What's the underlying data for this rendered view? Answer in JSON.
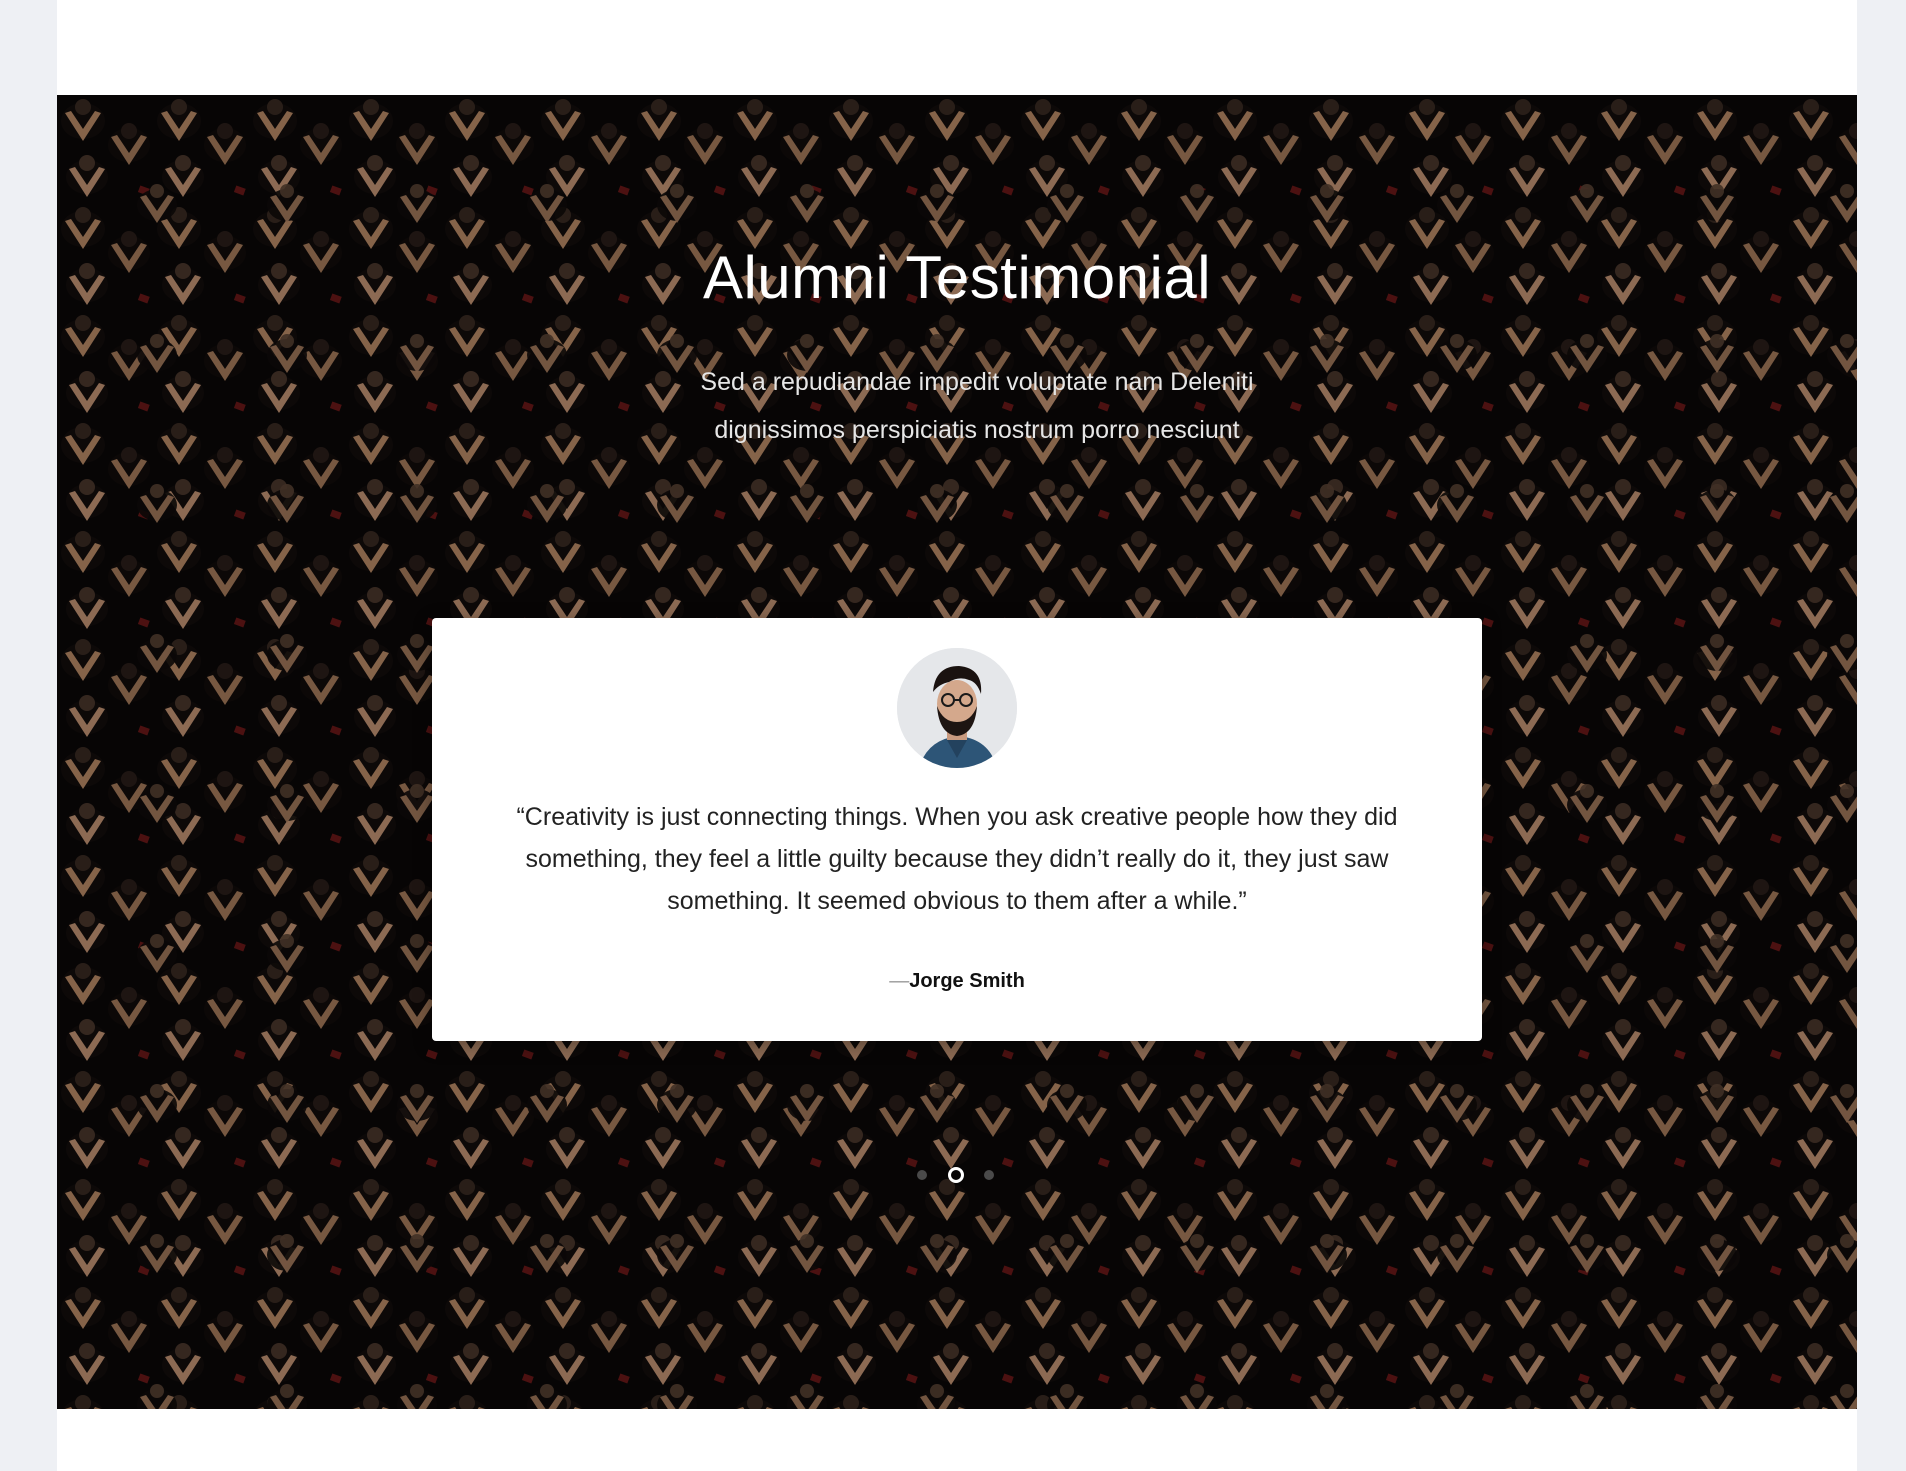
{
  "section": {
    "title": "Alumni Testimonial",
    "subtitle": "Sed a repudiandae impedit voluptate nam Deleniti dignissimos perspiciatis nostrum porro nesciunt",
    "background": "graduates-crowd-photo"
  },
  "testimonial": {
    "avatar": "person-photo",
    "quote": "“Creativity is just connecting things. When you ask creative people how they did something, they feel a little guilty because they didn’t really do it, they just saw something. It seemed obvious to them after a while.”",
    "author_prefix": "—",
    "author": "Jorge Smith"
  },
  "carousel": {
    "slides": 3,
    "active_index": 1
  },
  "colors": {
    "page_bg": "#eef0f4",
    "card_bg": "#ffffff",
    "gown": "#0c0a0a",
    "hood": "#b98a66",
    "hair": "#3a2a22"
  }
}
